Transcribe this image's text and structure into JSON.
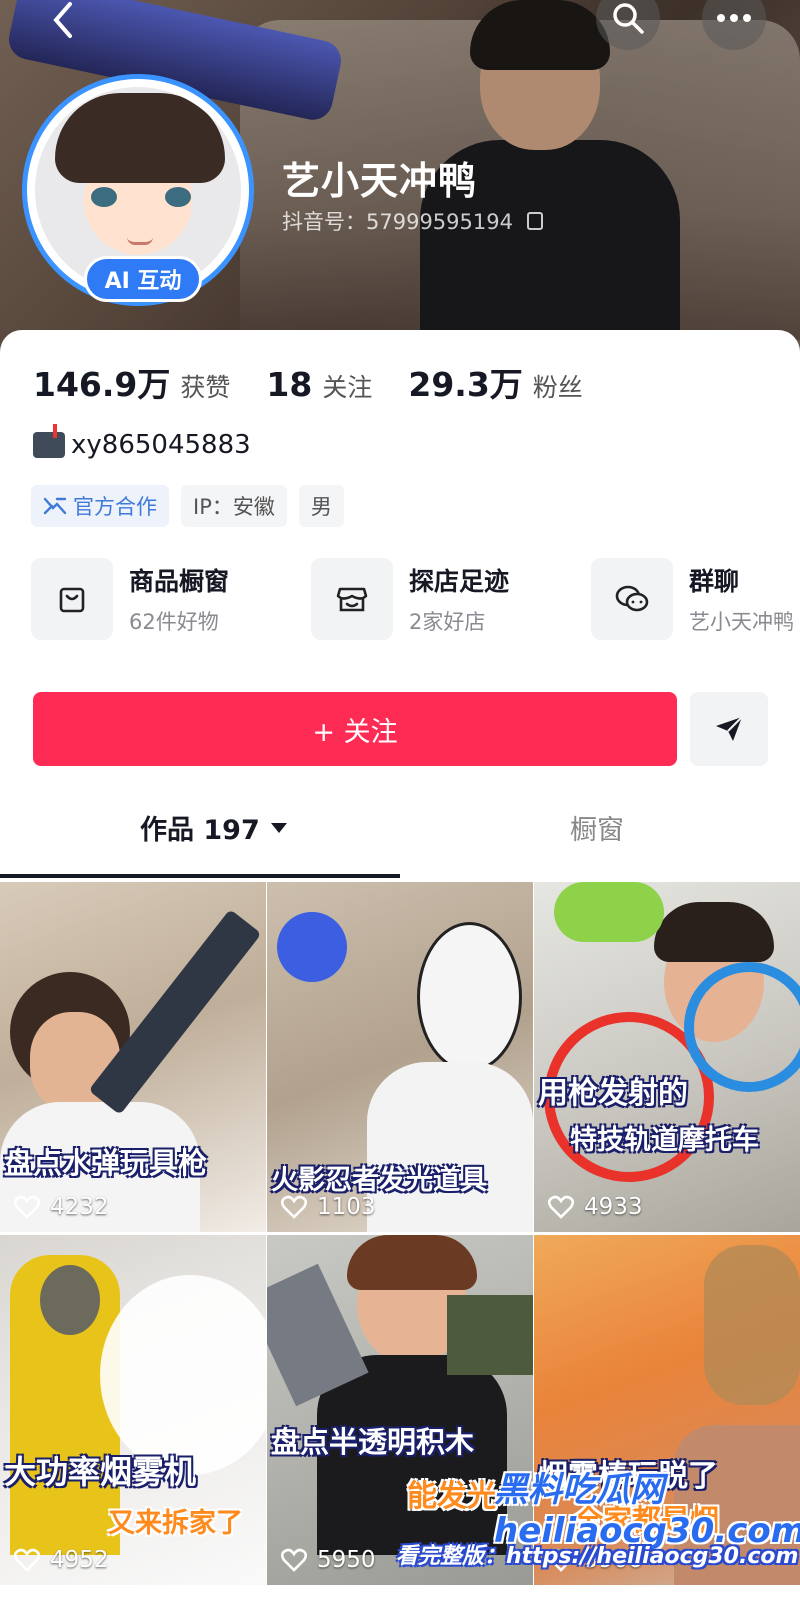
{
  "header": {
    "back_icon": "chevron-left-icon",
    "search_icon": "search-icon",
    "more_icon": "more-dots-icon",
    "ai_badge": "AI 互动",
    "nickname": "艺小天冲鸭",
    "douyin_id": "抖音号：57999595194"
  },
  "stats": [
    {
      "value": "146.9万",
      "label": "获赞"
    },
    {
      "value": "18",
      "label": "关注"
    },
    {
      "value": "29.3万",
      "label": "粉丝"
    }
  ],
  "bio": "xy865045883",
  "tags": [
    {
      "label": "官方合作",
      "icon": "cooperation-icon"
    },
    {
      "label": "IP：安徽"
    },
    {
      "label": "男"
    }
  ],
  "shortcuts": [
    {
      "title": "商品橱窗",
      "subtitle": "62件好物",
      "icon": "shopping-bag-icon"
    },
    {
      "title": "探店足迹",
      "subtitle": "2家好店",
      "icon": "store-icon"
    },
    {
      "title": "群聊",
      "subtitle": "艺小天冲鸭",
      "icon": "chat-icon"
    }
  ],
  "actions": {
    "follow_label": "+ 关注",
    "share_icon": "send-icon"
  },
  "tabs": {
    "works_label": "作品 197",
    "window_label": "橱窗"
  },
  "videos": [
    {
      "captions": [
        "盘点水弹玩具枪"
      ],
      "likes": "4232"
    },
    {
      "captions": [
        "火影忍者发光道具"
      ],
      "likes": "1103"
    },
    {
      "captions": [
        "用枪发射的",
        "特技轨道摩托车"
      ],
      "likes": "4933"
    },
    {
      "captions": [
        "大功率烟雾机",
        "又来拆家了"
      ],
      "likes": "4952"
    },
    {
      "captions": [
        "盘点半透明积木",
        "能发光"
      ],
      "likes": "5950"
    },
    {
      "captions": [
        "烟雾棒玩脱了",
        "全家都是烟"
      ],
      "likes": "5906"
    }
  ],
  "watermark": {
    "line1": "黑料吃瓜网 heiliaocg30.com",
    "line2": "看完整版：https://heiliaocg30.com"
  },
  "colors": {
    "accent_red": "#fe2c55",
    "ai_blue": "#2f7bf5",
    "official_blue": "#3f7ad9"
  }
}
